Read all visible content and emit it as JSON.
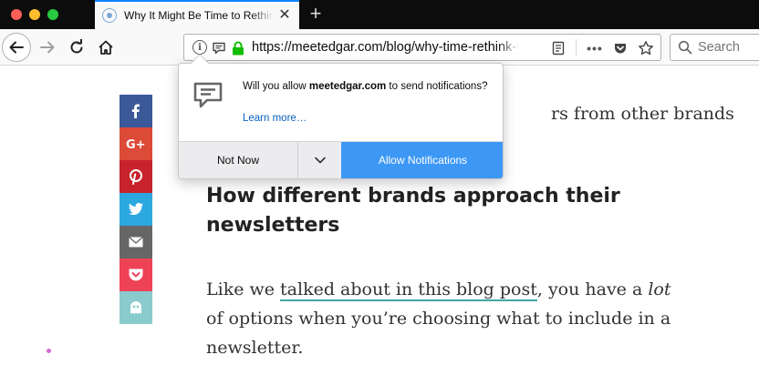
{
  "window": {
    "tab_title": "Why It Might Be Time to Rethink Your Newsletter",
    "tab_close_glyph": "✕",
    "new_tab_glyph": "+"
  },
  "navbar": {
    "url": "https://meetedgar.com/blog/why-time-rethink-your-newsletter/",
    "search_placeholder": "Search",
    "page_actions_glyph": "•••"
  },
  "popup": {
    "message_prefix": "Will you allow ",
    "message_domain": "meetedgar.com",
    "message_suffix": " to send notifications?",
    "learn_more": "Learn more…",
    "not_now": "Not Now",
    "allow": "Allow Notifications"
  },
  "share_bar": [
    {
      "network": "facebook",
      "color": "#3b5998",
      "icon": "facebook-icon"
    },
    {
      "network": "google-plus",
      "color": "#dc4a38",
      "icon": "google-plus-icon"
    },
    {
      "network": "pinterest",
      "color": "#c8232c",
      "icon": "pinterest-icon"
    },
    {
      "network": "twitter",
      "color": "#2ca8e1",
      "icon": "twitter-icon"
    },
    {
      "network": "email",
      "color": "#666666",
      "icon": "envelope-icon"
    },
    {
      "network": "pocket",
      "color": "#ee4256",
      "icon": "pocket-icon"
    },
    {
      "network": "edgar",
      "color": "#8acbcd",
      "icon": "edgar-icon"
    }
  ],
  "article": {
    "intro_visible": "rs from other brands",
    "heading": "How different brands approach their newsletters",
    "para_start": "Like we ",
    "para_link": "talked about in this blog post",
    "para_mid": ", you have a ",
    "para_em": "lot",
    "para_end": " of options when you’re choosing what to include in a newsletter."
  },
  "colors": {
    "accent": "#0a84ff",
    "allow_button": "#3d98f5",
    "link_underline": "#3aa7a7",
    "lock_green": "#12bc00"
  }
}
